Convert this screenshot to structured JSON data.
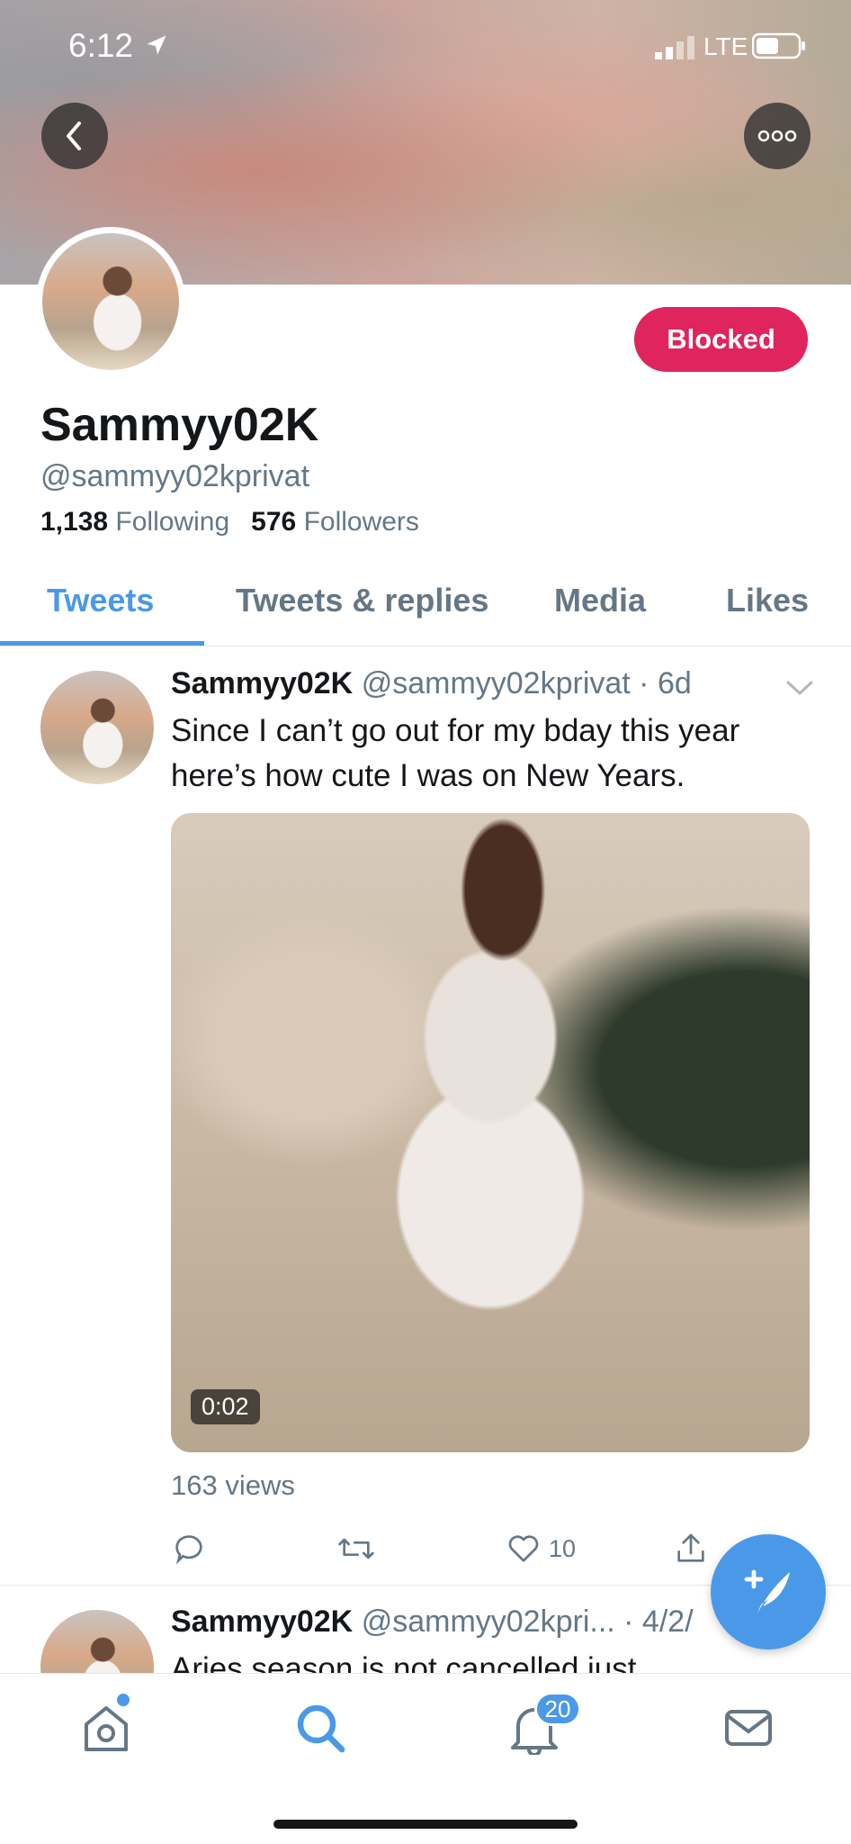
{
  "status_bar": {
    "time": "6:12",
    "network": "LTE"
  },
  "profile": {
    "display_name": "Sammyy02K",
    "handle": "@sammyy02kprivat",
    "following_count": "1,138",
    "following_label": "Following",
    "followers_count": "576",
    "followers_label": "Followers",
    "relationship_button": "Blocked"
  },
  "tabs": [
    {
      "label": "Tweets",
      "active": true
    },
    {
      "label": "Tweets & replies",
      "active": false
    },
    {
      "label": "Media",
      "active": false
    },
    {
      "label": "Likes",
      "active": false
    }
  ],
  "tweets": [
    {
      "name": "Sammyy02K",
      "handle_time": "@sammyy02kprivat · 6d",
      "text": "Since I can’t go out for my bday this year here’s how cute I was on New Years.",
      "media_duration": "0:02",
      "views": "163 views",
      "like_count": "10"
    },
    {
      "name": "Sammyy02K",
      "handle_time": "@sammyy02kpri... · 4/2/",
      "text": "Aries season is not cancelled just"
    }
  ],
  "notifications_badge": "20",
  "colors": {
    "accent": "#4a99e9",
    "blocked": "#e0245e",
    "secondary_text": "#657786"
  },
  "icons": [
    "back-icon",
    "more-icon",
    "reply-icon",
    "retweet-icon",
    "like-icon",
    "share-icon",
    "compose-icon",
    "home-icon",
    "search-icon",
    "notifications-icon",
    "messages-icon"
  ]
}
